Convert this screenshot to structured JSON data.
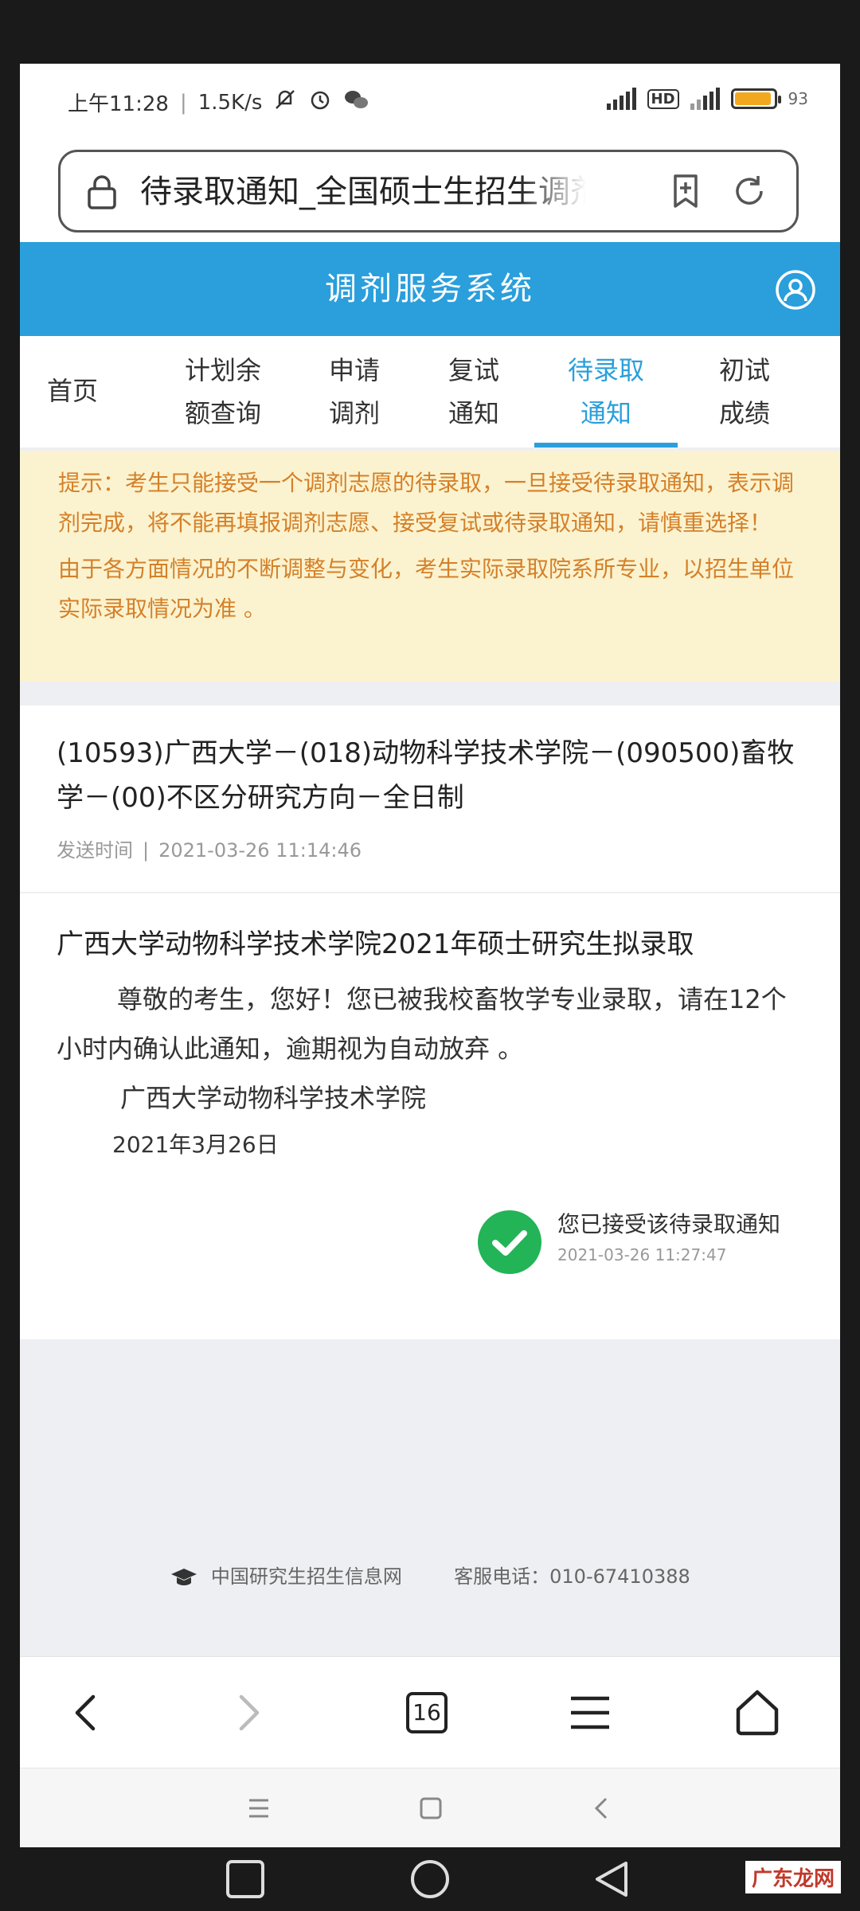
{
  "status_bar": {
    "time": "上午11:28",
    "speed": "1.5K/s",
    "battery_text": "93",
    "battery_percent": 93,
    "battery_color": "#f1a81f",
    "icons": [
      "mute-icon",
      "alarm-icon",
      "wechat-icon",
      "signal-icon",
      "hd-icon",
      "battery-icon"
    ]
  },
  "url_bar": {
    "text": "待录取通知_全国硕士生招生调剂服务系统"
  },
  "header": {
    "title": "调剂服务系统",
    "accent": "#2a9fdc"
  },
  "tabs": [
    {
      "label_1": "首页",
      "label_2": ""
    },
    {
      "label_1": "计划余",
      "label_2": "额查询"
    },
    {
      "label_1": "申请",
      "label_2": "调剂"
    },
    {
      "label_1": "复试",
      "label_2": "通知"
    },
    {
      "label_1": "待录取",
      "label_2": "通知",
      "active": true
    },
    {
      "label_1": "初试",
      "label_2": "成绩"
    }
  ],
  "notice": {
    "para1": "提示：考生只能接受一个调剂志愿的待录取，一旦接受待录取通知，表示调剂完成，将不能再填报调剂志愿、接受复试或待录取通知，请慎重选择！",
    "para2": "由于各方面情况的不断调整与变化，考生实际录取院系所专业，以招生单位实际录取情况为准 。",
    "color": "#d5802a"
  },
  "item": {
    "title": "(10593)广西大学－(018)动物科学技术学院－(090500)畜牧学－(00)不区分研究方向－全日制",
    "sent_label": "发送时间",
    "sent_time": "2021-03-26 11:14:46"
  },
  "letter": {
    "title": "广西大学动物科学技术学院2021年硕士研究生拟录取",
    "body": "尊敬的考生，您好！您已被我校畜牧学专业录取，请在12个小时内确认此通知，逾期视为自动放弃 。",
    "signer": "广西大学动物科学技术学院",
    "date": "2021年3月26日"
  },
  "accepted": {
    "text": "您已接受该待录取通知",
    "time": "2021-03-26 11:27:47",
    "color": "#22b456"
  },
  "footer": {
    "site": "中国研究生招生信息网",
    "phone_label": "客服电话：",
    "phone": "010-67410388"
  },
  "browser_toolbar": {
    "tab_count": "16"
  },
  "watermark": "广东龙网"
}
